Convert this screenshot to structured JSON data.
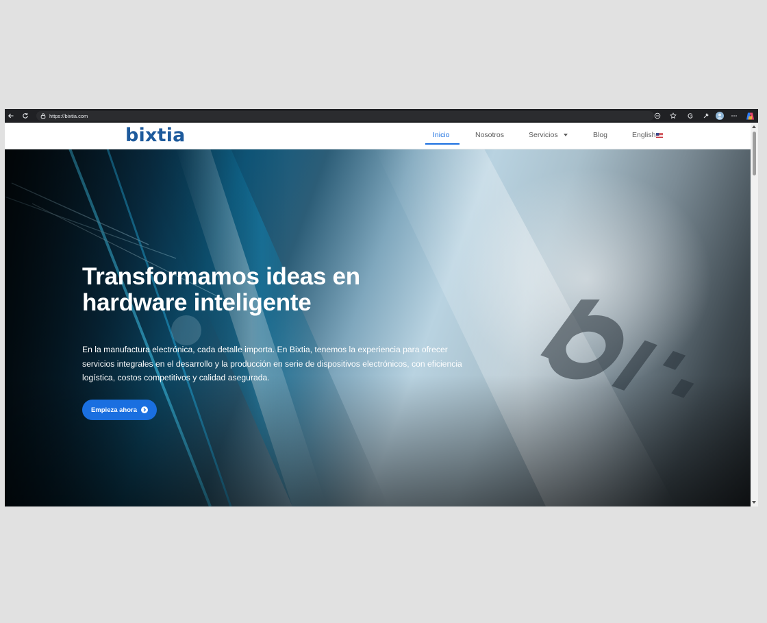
{
  "browser": {
    "url": "https://bixtia.com"
  },
  "site": {
    "logo": "bixtia",
    "nav": [
      {
        "label": "Inicio",
        "active": true
      },
      {
        "label": "Nosotros",
        "active": false
      },
      {
        "label": "Servicios",
        "active": false
      },
      {
        "label": "Blog",
        "active": false
      },
      {
        "label": "English",
        "active": false
      }
    ]
  },
  "hero": {
    "title_line1": "Transformamos ideas en",
    "title_line2": "hardware inteligente",
    "description": "En la manufactura electrónica, cada detalle importa. En Bixtia, tenemos la experiencia para ofrecer servicios integrales en el desarrollo y la producción en serie de dispositivos electrónicos, con eficiencia logística, costos competitivos y calidad asegurada.",
    "cta_label": "Empieza ahora",
    "background_watermark": "bix"
  },
  "colors": {
    "accent": "#1a6fe0",
    "logo": "#1d5a9c",
    "browser_chrome": "#202124"
  },
  "icons": [
    "back-icon",
    "refresh-icon",
    "site-info-icon",
    "reader-mode-icon",
    "favorites-star-icon",
    "collections-icon",
    "extensions-icon",
    "profile-avatar-icon",
    "more-menu-icon",
    "copilot-icon",
    "dropdown-caret-icon",
    "us-flag-icon",
    "arrow-circle-right-icon"
  ]
}
